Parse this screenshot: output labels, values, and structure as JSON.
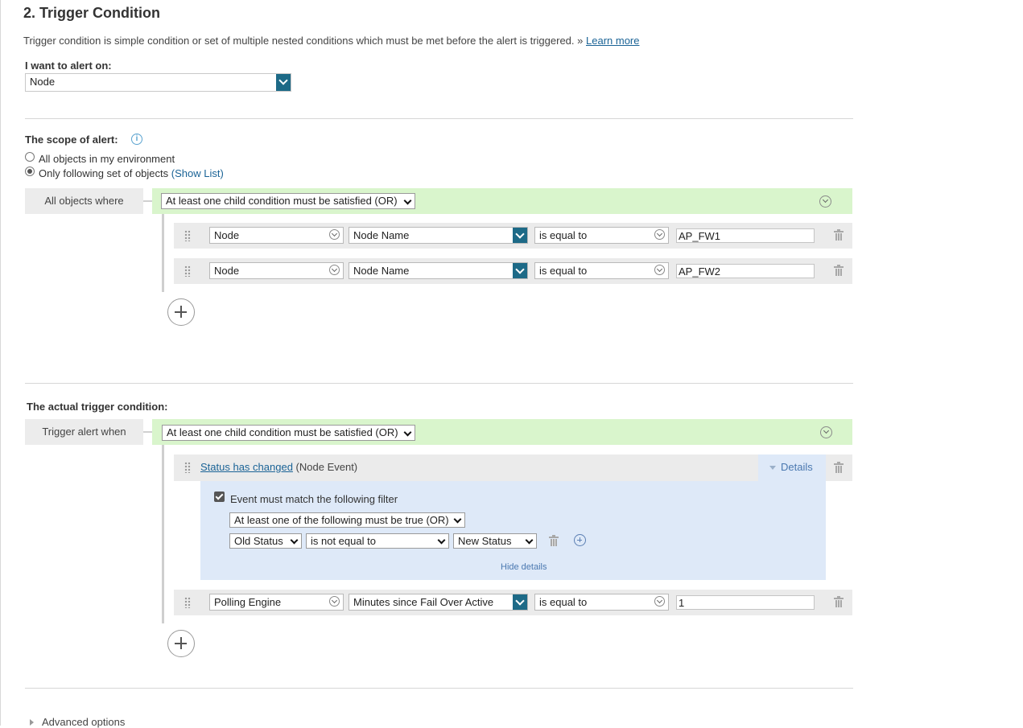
{
  "header": {
    "title": "2. Trigger Condition",
    "description": "Trigger condition is simple condition or set of multiple nested conditions which must be met before the alert is triggered. »",
    "learn_more": "Learn more"
  },
  "alert_on": {
    "label": "I want to alert on:",
    "value": "Node"
  },
  "scope": {
    "label": "The scope of alert:",
    "options": [
      {
        "label": "All objects in my environment",
        "selected": false
      },
      {
        "label": "Only following set of objects",
        "selected": true
      }
    ],
    "show_list": "(Show List)",
    "group_label": "All objects where",
    "group_operator": "At least one child condition must be satisfied (OR)",
    "conditions": [
      {
        "object": "Node",
        "property": "Node Name",
        "operator": "is equal to",
        "value": "AP_FW1"
      },
      {
        "object": "Node",
        "property": "Node Name",
        "operator": "is equal to",
        "value": "AP_FW2"
      }
    ]
  },
  "trigger": {
    "label": "The actual trigger condition:",
    "group_label": "Trigger alert when",
    "group_operator": "At least one child condition must be satisfied (OR)",
    "event": {
      "link": "Status has changed",
      "suffix": "(Node Event)",
      "details_label": "Details",
      "filter_checkbox_label": "Event must match the following filter",
      "filter_checked": true,
      "filter_operator": "At least one of the following must be true (OR)",
      "filter_field": "Old Status",
      "filter_comparison": "is not equal to",
      "filter_value": "New Status",
      "hide_details": "Hide details"
    },
    "condition": {
      "object": "Polling Engine",
      "property": "Minutes since Fail Over Active",
      "operator": "is equal to",
      "value": "1"
    }
  },
  "advanced": {
    "label": "Advanced options"
  },
  "colors": {
    "group_bar": "#d9f5cc",
    "details_panel": "#dee9f8",
    "dropdown_accent": "#1d6a87",
    "link": "#1a6396"
  }
}
